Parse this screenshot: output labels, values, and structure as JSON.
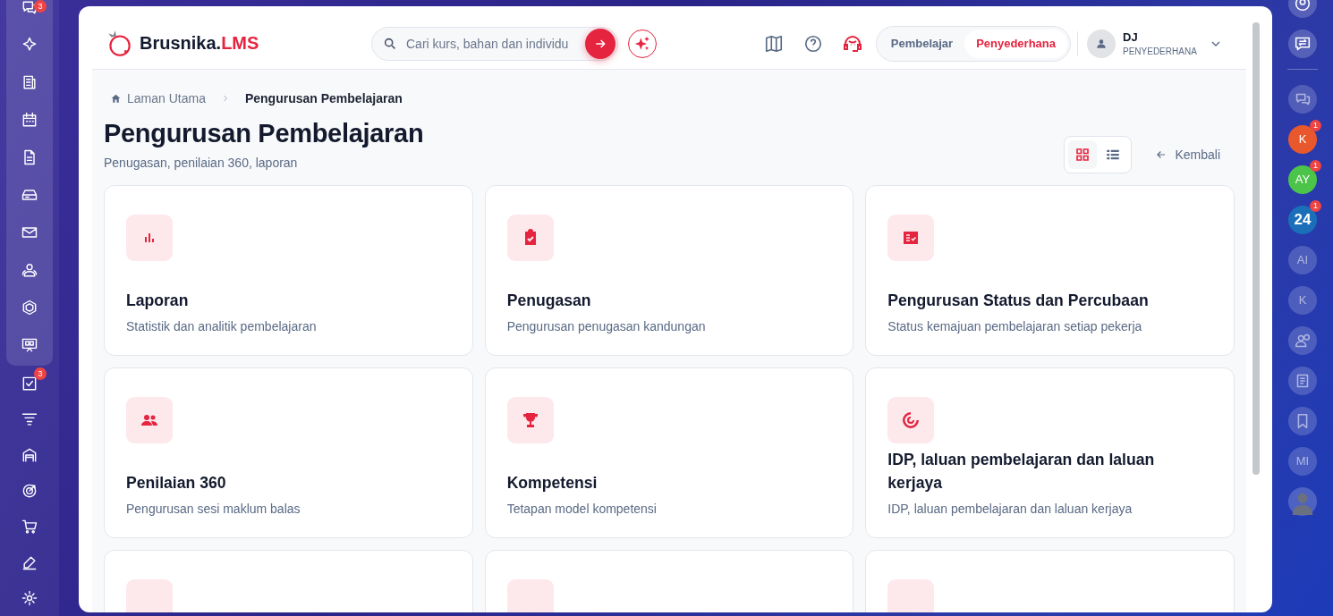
{
  "left_dock": {
    "messages_badge": "3",
    "tasks_badge": "3"
  },
  "header": {
    "logo": {
      "brand": "Brusnika.",
      "suffix": "LMS"
    },
    "search": {
      "placeholder": "Cari kurs, bahan dan individu"
    },
    "roles": [
      {
        "label": "Pembelajar",
        "selected": false
      },
      {
        "label": "Penyederhana",
        "selected": true
      }
    ],
    "user": {
      "initials": "DJ",
      "role": "PENYEDERHANA"
    }
  },
  "breadcrumb": [
    {
      "label": "Laman Utama",
      "selected": false
    },
    {
      "label": "Pengurusan Pembelajaran",
      "selected": true
    }
  ],
  "page": {
    "title": "Pengurusan Pembelajaran",
    "subtitle": "Penugasan, penilaian 360, laporan",
    "back": "Kembali"
  },
  "view_toggle": [
    {
      "kind": "grid",
      "selected": true
    },
    {
      "kind": "list",
      "selected": false
    }
  ],
  "cards": [
    {
      "title": "Laporan",
      "description": "Statistik dan analitik pembelajaran"
    },
    {
      "title": "Penugasan",
      "description": "Pengurusan penugasan kandungan"
    },
    {
      "title": "Pengurusan Status dan Percubaan",
      "description": "Status kemajuan pembelajaran setiap pekerja"
    },
    {
      "title": "Penilaian 360",
      "description": "Pengurusan sesi maklum balas"
    },
    {
      "title": "Kompetensi",
      "description": "Tetapan model kompetensi"
    },
    {
      "title": "IDP, laluan pembelajaran dan laluan kerjaya",
      "description": "IDP, laluan pembelajaran dan laluan kerjaya"
    }
  ],
  "right_dock": [
    {
      "kind": "icon",
      "active": true
    },
    {
      "kind": "icon",
      "active": true
    },
    {
      "kind": "icon",
      "active": false
    },
    {
      "kind": "initials",
      "text": "K",
      "color": "#e8582c",
      "badge": "1",
      "active": true
    },
    {
      "kind": "initials",
      "text": "AY",
      "color": "#4cc44a",
      "badge": "1",
      "active": true
    },
    {
      "kind": "initials",
      "text": "24",
      "color": "#1b6fb8",
      "badge": "1",
      "active": true
    },
    {
      "kind": "initials",
      "text": "AI",
      "active": false
    },
    {
      "kind": "initials",
      "text": "K",
      "active": false
    },
    {
      "kind": "icon",
      "active": false
    },
    {
      "kind": "icon",
      "active": false
    },
    {
      "kind": "icon",
      "active": false
    },
    {
      "kind": "initials",
      "text": "MI",
      "active": false
    },
    {
      "kind": "avatar",
      "active": true
    }
  ]
}
